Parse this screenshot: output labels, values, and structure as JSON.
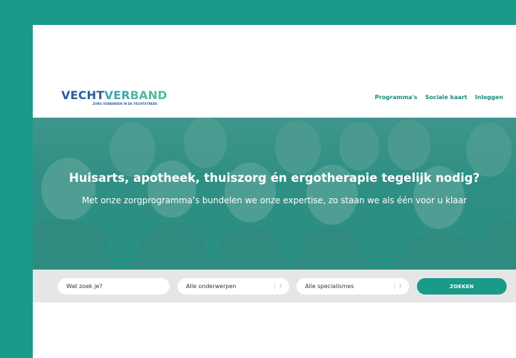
{
  "brand": {
    "logo_part1": "VECHT",
    "logo_part2": "VER",
    "logo_part3": "BAND",
    "tagline": "ZORG VERBINDEN IN DE VECHTSTREEK",
    "colors": {
      "primary": "#1a9b89",
      "logo_blue": "#2b5d9c",
      "logo_teal": "#3aa8b0"
    }
  },
  "nav": {
    "items": [
      {
        "label": "Programma's"
      },
      {
        "label": "Sociale kaart"
      },
      {
        "label": "Inloggen"
      }
    ]
  },
  "hero": {
    "title": "Huisarts, apotheek, thuiszorg én ergotherapie tegelijk nodig?",
    "subtitle": "Met onze zorgprogramma’s bundelen we onze expertise, zo staan we als één voor u klaar"
  },
  "search": {
    "input_placeholder": "Wat zoek je?",
    "topic_select": "Alle onderwerpen",
    "specialism_select": "Alle specialismes",
    "button_label": "ZOEKEN"
  },
  "icons": [
    "select-arrows-icon"
  ]
}
